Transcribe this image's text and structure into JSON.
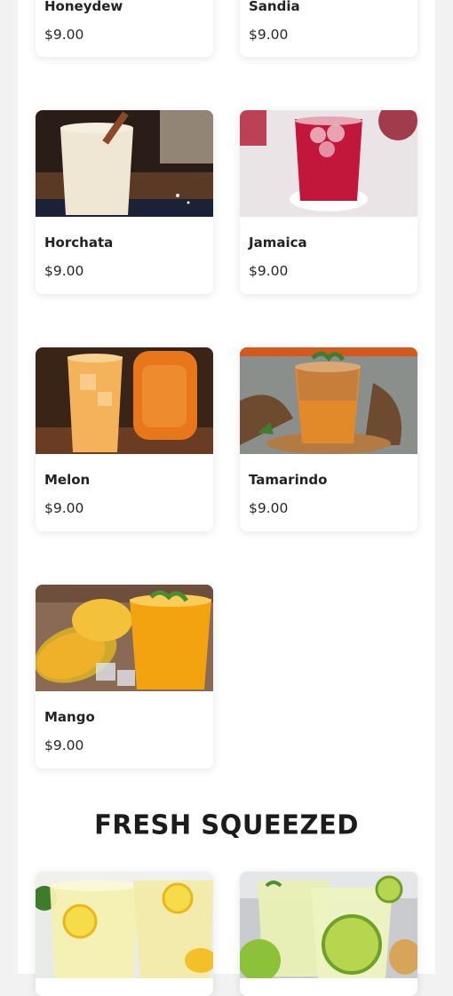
{
  "products": [
    {
      "name": "Honeydew",
      "price": "$9.00"
    },
    {
      "name": "Sandia",
      "price": "$9.00"
    },
    {
      "name": "Horchata",
      "price": "$9.00"
    },
    {
      "name": "Jamaica",
      "price": "$9.00"
    },
    {
      "name": "Melon",
      "price": "$9.00"
    },
    {
      "name": "Tamarindo",
      "price": "$9.00"
    },
    {
      "name": "Mango",
      "price": "$9.00"
    }
  ],
  "fresh_section": {
    "title": "FRESH SQUEEZED"
  }
}
